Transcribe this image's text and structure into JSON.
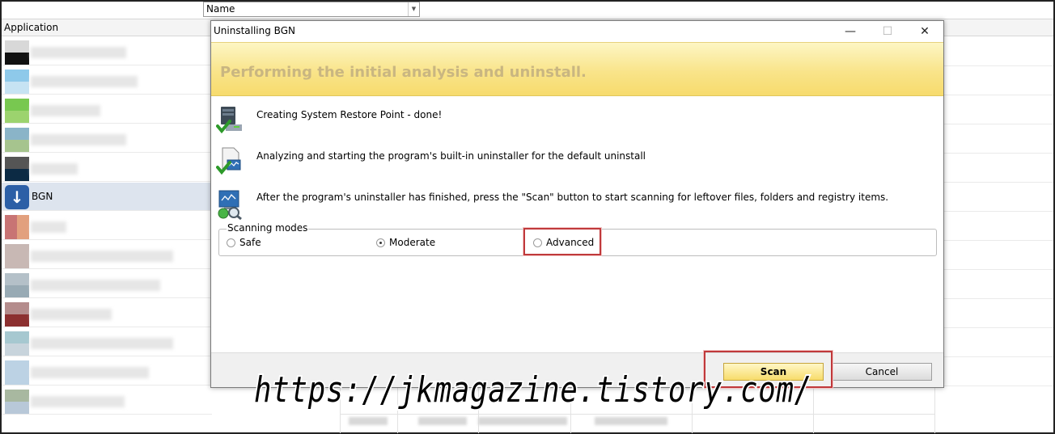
{
  "background_app": {
    "filter_combo_value": "Name",
    "column_header": "Application",
    "selected_app_label": "BGN"
  },
  "dialog": {
    "title": "Uninstalling BGN",
    "window_buttons": {
      "minimize": "—",
      "maximize": "☐",
      "close": "✕"
    },
    "banner_heading": "Performing the initial analysis and uninstall.",
    "steps": [
      {
        "icon": "restore-point-check-icon",
        "text": "Creating System Restore Point - done!"
      },
      {
        "icon": "uninstaller-check-icon",
        "text": "Analyzing and starting the program's built-in uninstaller for the default uninstall"
      },
      {
        "icon": "scan-magnifier-icon",
        "text": "After the program's uninstaller has finished, press the \"Scan\" button to start scanning for leftover files, folders and registry items."
      }
    ],
    "scanning_modes": {
      "legend": "Scanning modes",
      "options": [
        "Safe",
        "Moderate",
        "Advanced"
      ],
      "selected": "Moderate"
    },
    "buttons": {
      "scan": "Scan",
      "cancel": "Cancel"
    }
  },
  "watermark": "https://jkmagazine.tistory.com/",
  "colors": {
    "banner_top": "#fdf6c4",
    "banner_bottom": "#f7db6d",
    "banner_text": "#c9b681",
    "highlight_red": "#c0393b",
    "selected_row": "#dde4ee"
  }
}
